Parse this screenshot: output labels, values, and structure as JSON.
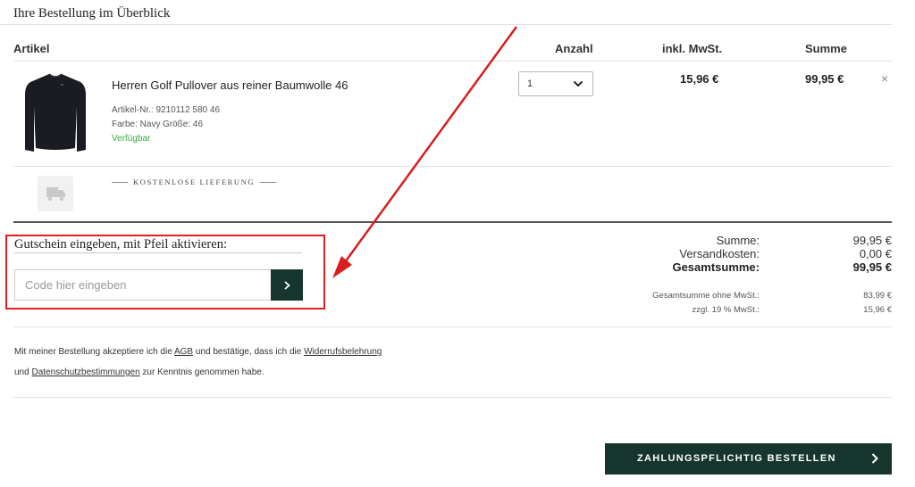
{
  "page": {
    "title": "Ihre Bestellung im Überblick"
  },
  "columns": {
    "article": "Artikel",
    "quantity": "Anzahl",
    "vat": "inkl. MwSt.",
    "sum": "Summe"
  },
  "item": {
    "image_icon": "black-pullover-image",
    "name": "Herren Golf Pullover aus reiner Baumwolle 46",
    "article_no": "Artikel-Nr.: 9210112 580 46",
    "color": "Farbe: Navy",
    "size": "Größe: 46",
    "availability": "Verfügbar",
    "quantity": "1",
    "vat_amount": "15,96 €",
    "total": "99,95 €",
    "remove_icon": "close-icon",
    "remove_glyph": "×"
  },
  "delivery": {
    "icon": "truck-icon",
    "label": "KOSTENLOSE LIEFERUNG"
  },
  "voucher": {
    "title": "Gutschein eingeben, mit Pfeil aktivieren:",
    "placeholder": "Code hier eingeben",
    "submit_icon": "chevron-right-icon"
  },
  "summary": {
    "subtotal_label": "Summe:",
    "subtotal_value": "99,95 €",
    "shipping_label": "Versandkosten:",
    "shipping_value": "0,00 €",
    "grand_total_label": "Gesamtsumme:",
    "grand_total_value": "99,95 €",
    "net_label": "Gesamtsumme ohne MwSt.:",
    "net_value": "83,99 €",
    "tax_label": "zzgl. 19 % MwSt.:",
    "tax_value": "15,96 €"
  },
  "legal": {
    "line1_prefix": "Mit meiner Bestellung akzeptiere ich die ",
    "agb_link": "AGB",
    "line1_middle": " und bestätige, dass ich die ",
    "withdrawal_link": "Widerrufsbelehrung",
    "line2_prefix": "und ",
    "privacy_link": "Datenschutzbestimmungen",
    "line2_suffix": " zur Kenntnis genommen habe."
  },
  "order_button": {
    "label": "ZAHLUNGSPFLICHTIG BESTELLEN",
    "icon": "chevron-right-icon"
  },
  "colors": {
    "brand_dark_green": "#16352c",
    "availability_green": "#3fa64b",
    "annotation_red": "#e01f1f"
  }
}
